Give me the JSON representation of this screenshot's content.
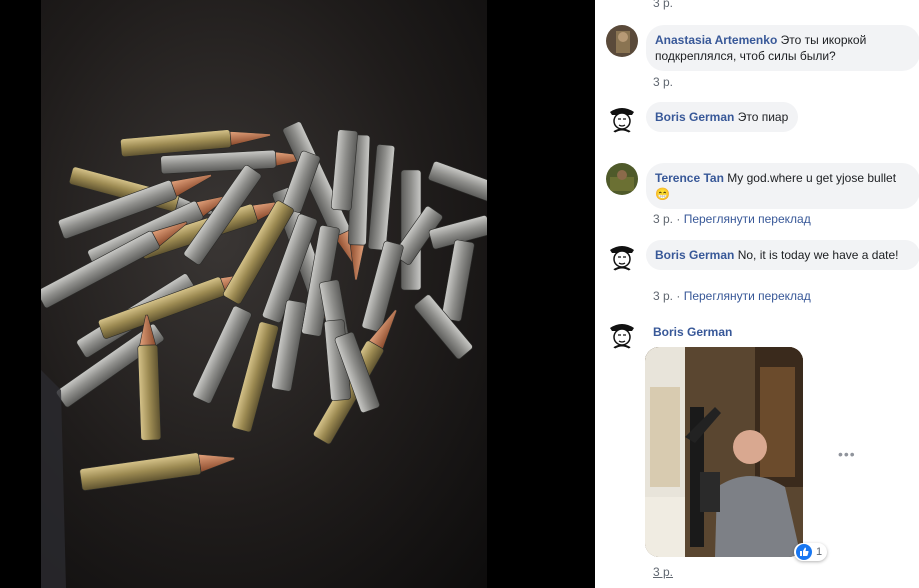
{
  "photo": {
    "name": "bullets-photo"
  },
  "comments": [
    {
      "meta": "3 р."
    },
    {
      "author": "Anastasia Artemenko",
      "text": "Это ты икоркой подкреплялся, чтоб силы были?",
      "meta": "3 р."
    },
    {
      "author": "Boris German",
      "text": "Это пиар",
      "meta": ""
    },
    {
      "author": "Terence Tan",
      "text": "My god.where u get yjose bullet",
      "emoji": "😁",
      "meta": "3 р.",
      "translate": "Переглянути переклад"
    },
    {
      "author": "Boris German",
      "text": "No, it is today we have a date!",
      "meta": "3 р.",
      "translate": "Переглянути переклад"
    },
    {
      "author": "Boris German",
      "meta": "3 р.",
      "reaction_count": "1",
      "more": "•••"
    }
  ],
  "separator": "·",
  "colors": {
    "link": "#385898",
    "bubble": "#f2f3f5",
    "meta": "#606770",
    "like": "#1877f2"
  }
}
